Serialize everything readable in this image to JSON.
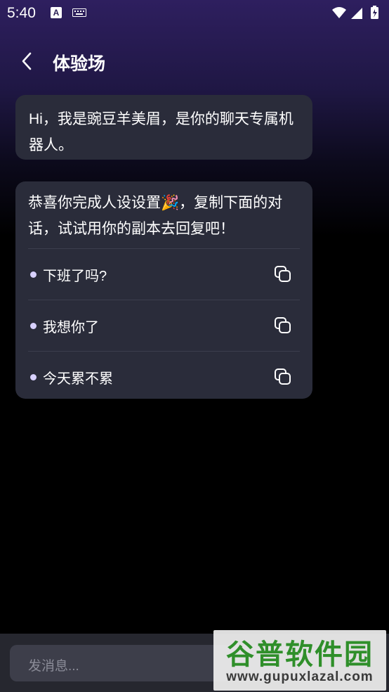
{
  "status_bar": {
    "time": "5:40",
    "notification_icons": [
      "a-icon",
      "keyboard-icon"
    ],
    "system_icons": [
      "wifi-icon",
      "signal-icon",
      "battery-icon"
    ]
  },
  "header": {
    "title": "体验场",
    "back_icon": "chevron-left-icon"
  },
  "messages": [
    {
      "text": "Hi，我是豌豆羊美眉，是你的聊天专属机器人。"
    },
    {
      "text": "恭喜你完成人设设置🎉，复制下面的对话，试试用你的副本去回复吧！"
    }
  ],
  "suggestions": [
    {
      "text": "下班了吗?"
    },
    {
      "text": "我想你了"
    },
    {
      "text": "今天累不累"
    }
  ],
  "composer": {
    "placeholder": "发消息..."
  },
  "watermark": {
    "main": "谷普软件园",
    "sub": "www.gupuxlazal.com"
  },
  "colors": {
    "header_gradient": "#2e1f5f",
    "bubble": "#2a2c3a",
    "bullet": "#d8d1ff",
    "composer_bg": "#26272f"
  }
}
